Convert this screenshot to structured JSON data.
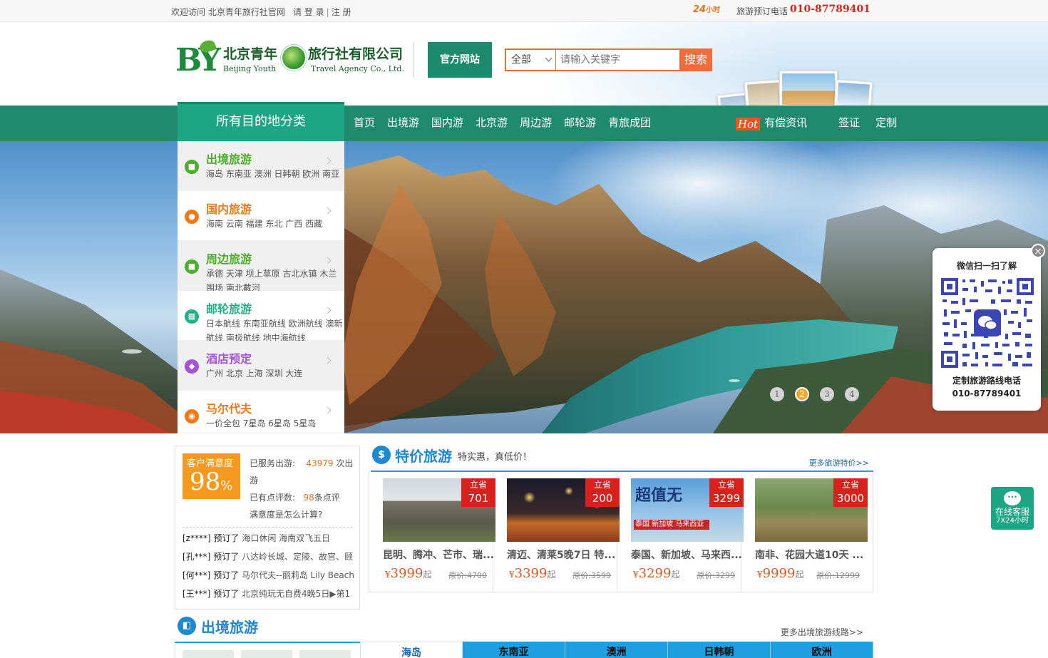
{
  "topbar": {
    "welcome": "欢迎访问 北京青年旅行社官网",
    "login": "请 登 录",
    "sep": "|",
    "register": "注 册",
    "badge_24_num": "24",
    "badge_24_unit": "小时",
    "phone_label": "旅游预订电话",
    "phone": "010-87789401"
  },
  "header": {
    "logo_mark": "BY",
    "logo_cn_part1": "北京青年",
    "logo_cn_part2": "旅行社有限公司",
    "logo_en_part1": "Beijing Youth",
    "logo_en_part2": "Travel Agency Co., Ltd.",
    "official_site": "官方网站",
    "search_scope": "全部",
    "search_placeholder": "请输入关键字",
    "search_button": "搜索"
  },
  "nav": {
    "all_categories": "所有目的地分类",
    "items": [
      "首页",
      "出境游",
      "国内游",
      "北京游",
      "周边游",
      "邮轮游",
      "青旅成团"
    ],
    "right_items": [
      "有偿资讯",
      "签证",
      "定制"
    ],
    "hot_badge": "Hot"
  },
  "categories": [
    {
      "title": "出境旅游",
      "sub": "海岛 东南亚 澳洲 日韩朝 欧洲 南亚",
      "color": "#4caf2a",
      "icon": "bus-icon"
    },
    {
      "title": "国内旅游",
      "sub": "海南 云南 福建 东北 广西 西藏",
      "color": "#f07a1a",
      "icon": "globe-icon"
    },
    {
      "title": "周边旅游",
      "sub": "承德 天津 坝上草原 古北水镇 木兰围场 南北戴河",
      "color": "#4caf2a",
      "icon": "train-icon"
    },
    {
      "title": "邮轮旅游",
      "sub": "日本航线 东南亚航线 欧洲航线 澳新航线 南极航线 地中海航线",
      "color": "#22b28a",
      "icon": "building-icon"
    },
    {
      "title": "酒店预定",
      "sub": "广州 北京 上海 深圳 大连",
      "color": "#a454d4",
      "icon": "cup-icon"
    },
    {
      "title": "马尔代夫",
      "sub": "一价全包 7星岛 6星岛 5星岛",
      "color": "#f07a1a",
      "icon": "camera-icon"
    }
  ],
  "banner": {
    "dots": [
      "1",
      "2",
      "3",
      "4"
    ],
    "active_dot": 1
  },
  "qr": {
    "title": "微信扫一扫了解",
    "line1": "定制旅游路线电话",
    "line2": "010-87789401",
    "close": "×"
  },
  "online": {
    "line1": "在线客服",
    "line2": "7X24小时"
  },
  "satisfaction": {
    "label": "客户满意度",
    "value": "98",
    "unit": "%",
    "served_label": "已服务出游:",
    "served_value": "43979",
    "served_unit": "次出游",
    "reviews_label": "已有点评数:",
    "reviews_value": "98",
    "reviews_unit": "条点评",
    "how": "满意度是怎么计算?",
    "orders": [
      {
        "user": "[z****]",
        "action": "预订了",
        "item": "海口休闲 海南双飞五日"
      },
      {
        "user": "[孔***]",
        "action": "预订了",
        "item": "八达岭长城、定陵、故宫、颐"
      },
      {
        "user": "[何***]",
        "action": "预订了",
        "item": "马尔代夫--丽莉岛 Lily Beach"
      },
      {
        "user": "[王***]",
        "action": "预订了",
        "item": "北京纯玩无自费4晚5日▶第1"
      }
    ]
  },
  "deals": {
    "title": "特价旅游",
    "subtitle": "特实惠，真低价！",
    "more": "更多旅游特价>>",
    "items": [
      {
        "save_label": "立省",
        "save": "701",
        "name": "昆明、腾冲、芒市、瑞...",
        "yen": "¥",
        "price": "3999",
        "qi": "起",
        "orig": "原价:4700"
      },
      {
        "save_label": "立省",
        "save": "200",
        "name": "清迈、清莱5晚7日 特...",
        "yen": "¥",
        "price": "3399",
        "qi": "起",
        "orig": "原价:3599"
      },
      {
        "save_label": "立省",
        "save": "3299",
        "name": "泰国、新加坡、马来西...",
        "yen": "¥",
        "price": "3299",
        "qi": "起",
        "orig": "原价:3299",
        "img_text": "超值无",
        "img_sub": "泰国 新加坡 马来西亚"
      },
      {
        "save_label": "立省",
        "save": "3000",
        "name": "南非、花园大道10天 ...",
        "yen": "¥",
        "price": "9999",
        "qi": "起",
        "orig": "原价:12999"
      }
    ]
  },
  "outbound": {
    "title": "出境旅游",
    "more": "更多出境旅游线路>>",
    "tabs": [
      "海岛",
      "东南亚",
      "澳洲",
      "日韩朝",
      "欧洲"
    ]
  }
}
